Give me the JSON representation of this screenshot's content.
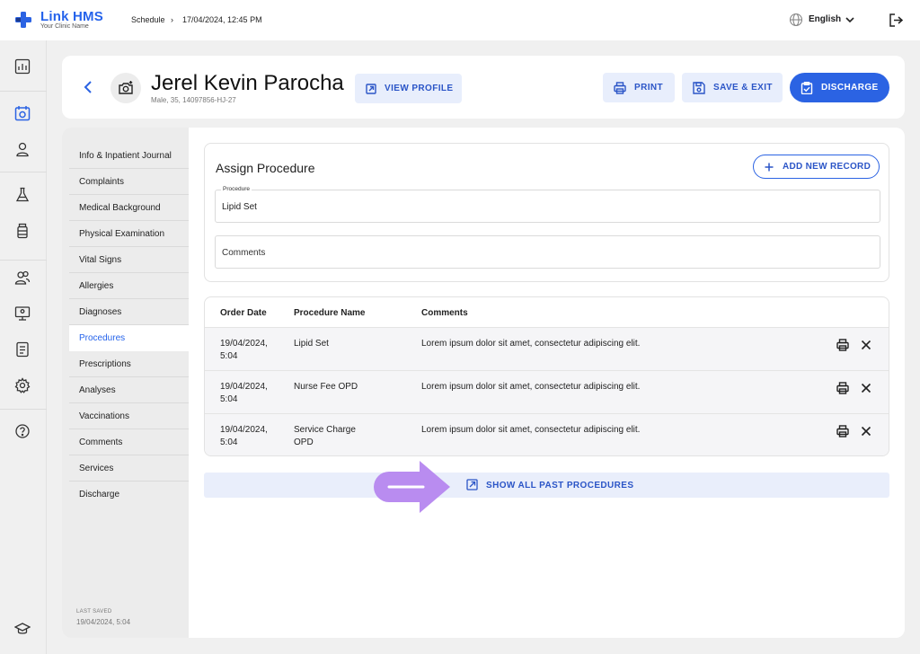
{
  "app": {
    "name": "Link HMS",
    "subtitle": "Your Clinic Name"
  },
  "breadcrumb": {
    "section": "Schedule",
    "separator": "›",
    "datetime": "17/04/2024, 12:45 PM"
  },
  "language": {
    "selected": "English"
  },
  "patient": {
    "name": "Jerel Kevin Parocha",
    "meta": "Male, 35, 14097856-HJ-27"
  },
  "header": {
    "view_profile": "VIEW PROFILE",
    "print": "PRINT",
    "save_exit": "SAVE & EXIT",
    "discharge": "DISCHARGE"
  },
  "sidebar": {
    "items": [
      {
        "label": "Info & Inpatient Journal"
      },
      {
        "label": "Complaints"
      },
      {
        "label": "Medical Background"
      },
      {
        "label": "Physical Examination"
      },
      {
        "label": "Vital Signs"
      },
      {
        "label": "Allergies"
      },
      {
        "label": "Diagnoses"
      },
      {
        "label": "Procedures",
        "active": true
      },
      {
        "label": "Prescriptions"
      },
      {
        "label": "Analyses"
      },
      {
        "label": "Vaccinations"
      },
      {
        "label": "Comments"
      },
      {
        "label": "Services"
      },
      {
        "label": "Discharge"
      }
    ],
    "last_saved_label": "LAST SAVED",
    "last_saved_value": "19/04/2024, 5:04"
  },
  "assign": {
    "title": "Assign Procedure",
    "add_button": "ADD NEW RECORD",
    "procedure_label": "Procedure",
    "procedure_value": "Lipid Set",
    "comments_placeholder": "Comments"
  },
  "table": {
    "headers": [
      "Order Date",
      "Procedure Name",
      "Comments"
    ],
    "rows": [
      {
        "date_line1": "19/04/2024,",
        "date_line2": "5:04",
        "name_line1": "Lipid Set",
        "name_line2": "",
        "comment": "Lorem ipsum dolor sit amet, consectetur adipiscing elit."
      },
      {
        "date_line1": "19/04/2024,",
        "date_line2": "5:04",
        "name_line1": "Nurse Fee OPD",
        "name_line2": "",
        "comment": "Lorem ipsum dolor sit amet, consectetur adipiscing elit."
      },
      {
        "date_line1": "19/04/2024,",
        "date_line2": "5:04",
        "name_line1": "Service Charge",
        "name_line2": "OPD",
        "comment": "Lorem ipsum dolor sit amet, consectetur adipiscing elit."
      }
    ]
  },
  "show_all": "SHOW ALL PAST PROCEDURES",
  "colors": {
    "accent": "#2b63e3",
    "highlight_arrow": "#b98cf0"
  },
  "icons": {
    "rail": [
      "dashboard-icon",
      "calendar-icon",
      "user-icon",
      "flask-icon",
      "medicine-bottle-icon",
      "users-icon",
      "monitor-icon",
      "report-icon",
      "settings-icon",
      "help-icon",
      "graduation-cap-icon"
    ]
  }
}
